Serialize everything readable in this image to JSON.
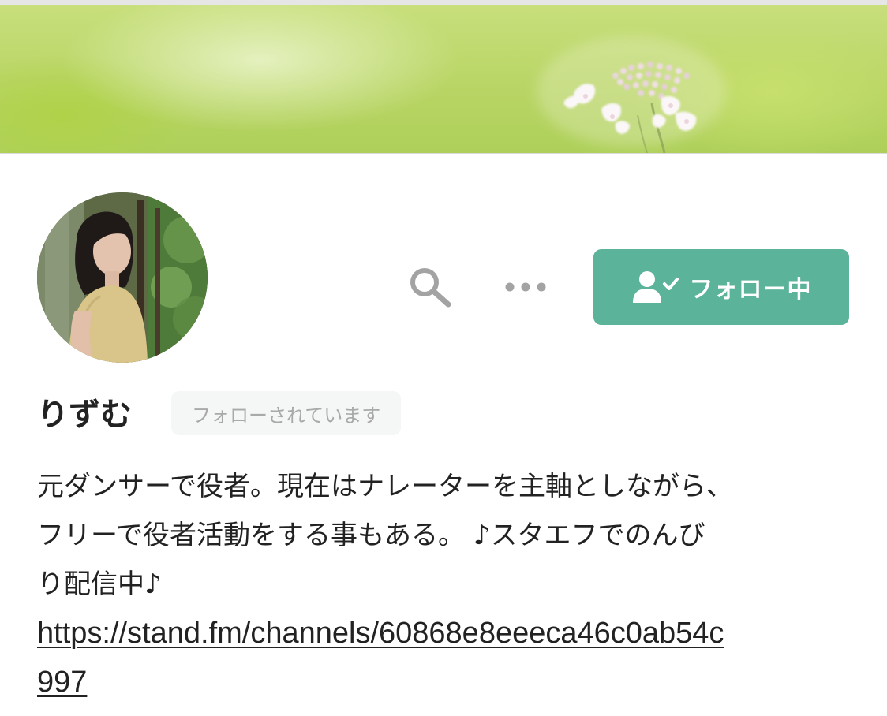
{
  "profile": {
    "name": "りずむ",
    "followed_badge": "フォローされています",
    "follow_button_label": "フォロー中",
    "bio_lines": [
      "元ダンサーで役者。現在はナレーターを主軸としながら、",
      "フリーで役者活動をする事もある。 ♪スタエフでのんび",
      "り配信中♪"
    ],
    "link_lines": [
      "https://stand.fm/channels/60868e8eeeca46c0ab54c",
      "997"
    ]
  },
  "icons": {
    "search": "search-icon",
    "more": "more-dots-icon",
    "follow": "person-check-icon"
  },
  "colors": {
    "follow_button": "#5bb39a",
    "badge_background": "#f5f6f6",
    "badge_text": "#a9a9a9",
    "icon_gray": "#a3a3a3"
  }
}
